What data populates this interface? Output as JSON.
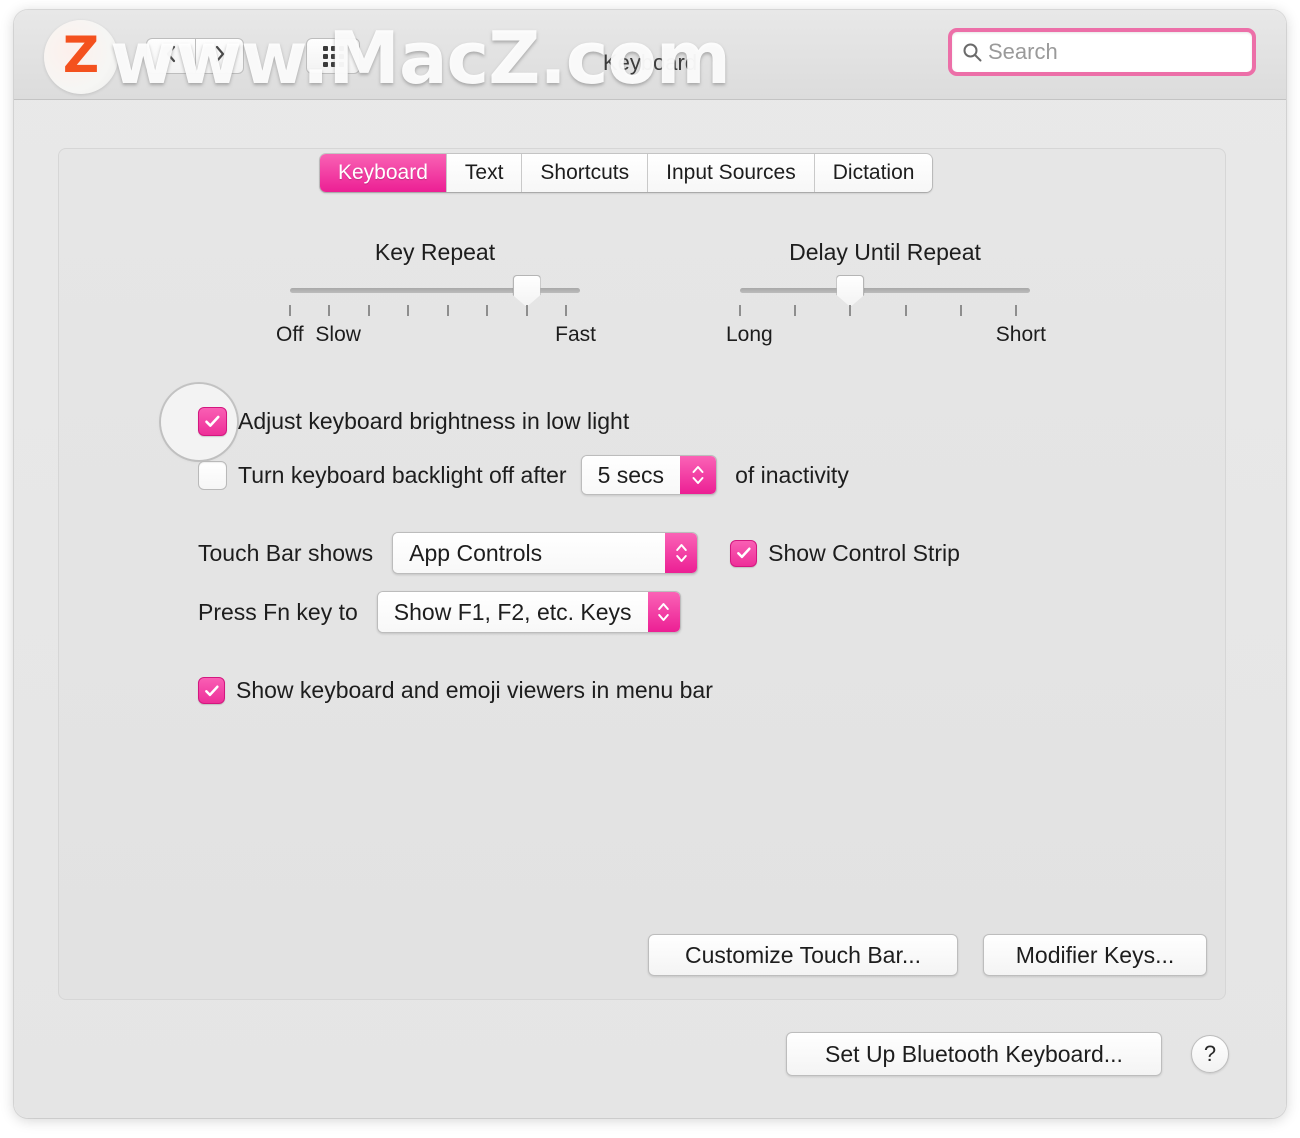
{
  "window": {
    "title": "Keyboard",
    "nav": {
      "back_icon": "chevron-left-icon",
      "forward_icon": "chevron-right-icon",
      "showall_icon": "grid-icon"
    },
    "search": {
      "placeholder": "Search",
      "value": "",
      "icon": "search-icon"
    }
  },
  "watermark": {
    "text": "www.MacZ.com",
    "logo_letter": "Z"
  },
  "tabs": [
    {
      "label": "Keyboard",
      "active": true
    },
    {
      "label": "Text",
      "active": false
    },
    {
      "label": "Shortcuts",
      "active": false
    },
    {
      "label": "Input Sources",
      "active": false
    },
    {
      "label": "Dictation",
      "active": false
    }
  ],
  "sliders": {
    "key_repeat": {
      "title": "Key Repeat",
      "ticks": 8,
      "value_index": 6,
      "labels": [
        {
          "text": "Off",
          "tick": 0
        },
        {
          "text": "Slow",
          "tick": 1
        },
        {
          "text": "Fast",
          "tick": 7
        }
      ]
    },
    "delay_until_repeat": {
      "title": "Delay Until Repeat",
      "ticks": 6,
      "value_index": 2,
      "labels": [
        {
          "text": "Long",
          "tick": 0
        },
        {
          "text": "Short",
          "tick": 5
        }
      ]
    }
  },
  "options": {
    "adjust_brightness": {
      "label": "Adjust keyboard brightness in low light",
      "checked": true,
      "focused": true
    },
    "backlight_off": {
      "label_before": "Turn keyboard backlight off after",
      "checked": false,
      "stepper_value": "5 secs",
      "label_after": "of inactivity"
    },
    "touch_bar": {
      "label": "Touch Bar shows",
      "value": "App Controls"
    },
    "control_strip": {
      "label": "Show Control Strip",
      "checked": true
    },
    "fn_key": {
      "label": "Press Fn key to",
      "value": "Show F1, F2, etc. Keys"
    },
    "emoji_viewers": {
      "label": "Show keyboard and emoji viewers in menu bar",
      "checked": true
    }
  },
  "buttons": {
    "customize_touch_bar": "Customize Touch Bar...",
    "modifier_keys": "Modifier Keys...",
    "setup_bluetooth": "Set Up Bluetooth Keyboard...",
    "help": "?"
  },
  "colors": {
    "accent_pink": "#ec1f94",
    "accent_pink_light": "#fa63b6",
    "search_border": "#ec6fa8",
    "logo_orange": "#f4511e"
  }
}
